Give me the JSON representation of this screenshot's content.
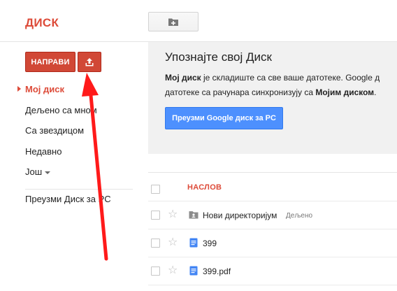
{
  "header": {
    "brand": "ДИСК",
    "new_folder_icon": "folder-plus-icon"
  },
  "sidebar": {
    "create_label": "НАПРАВИ",
    "upload_icon": "upload-icon",
    "items": [
      {
        "label": "Мој диск",
        "active": true
      },
      {
        "label": "Дељено са мном",
        "active": false
      },
      {
        "label": "Са звездицом",
        "active": false
      },
      {
        "label": "Недавно",
        "active": false
      },
      {
        "label": "Још",
        "active": false
      }
    ],
    "download_label": "Преузми Диск за PC"
  },
  "welcome": {
    "title": "Упознајте свој Диск",
    "line1_bold": "Мој диск",
    "line1_rest": " је складиште са све ваше датотеке. Google д",
    "line2_start": "датотеке са рачунара синхронизују са ",
    "line2_bold": "Мојим диском",
    "line2_end": ".",
    "button_label": "Преузми Google диск за PC"
  },
  "files": {
    "column_title": "НАСЛОВ",
    "rows": [
      {
        "name": "Нови директоријум",
        "tag": "Дељено",
        "icon": "shared-folder-icon"
      },
      {
        "name": "399",
        "tag": "",
        "icon": "google-doc-icon"
      },
      {
        "name": "399.pdf",
        "tag": "",
        "icon": "google-doc-icon"
      }
    ]
  },
  "colors": {
    "brand_red": "#dd4b39",
    "create_button": "#d14836",
    "primary_blue": "#4d90fe",
    "annotation_arrow": "#ff1a1a",
    "doc_icon_blue": "#4285f4"
  }
}
